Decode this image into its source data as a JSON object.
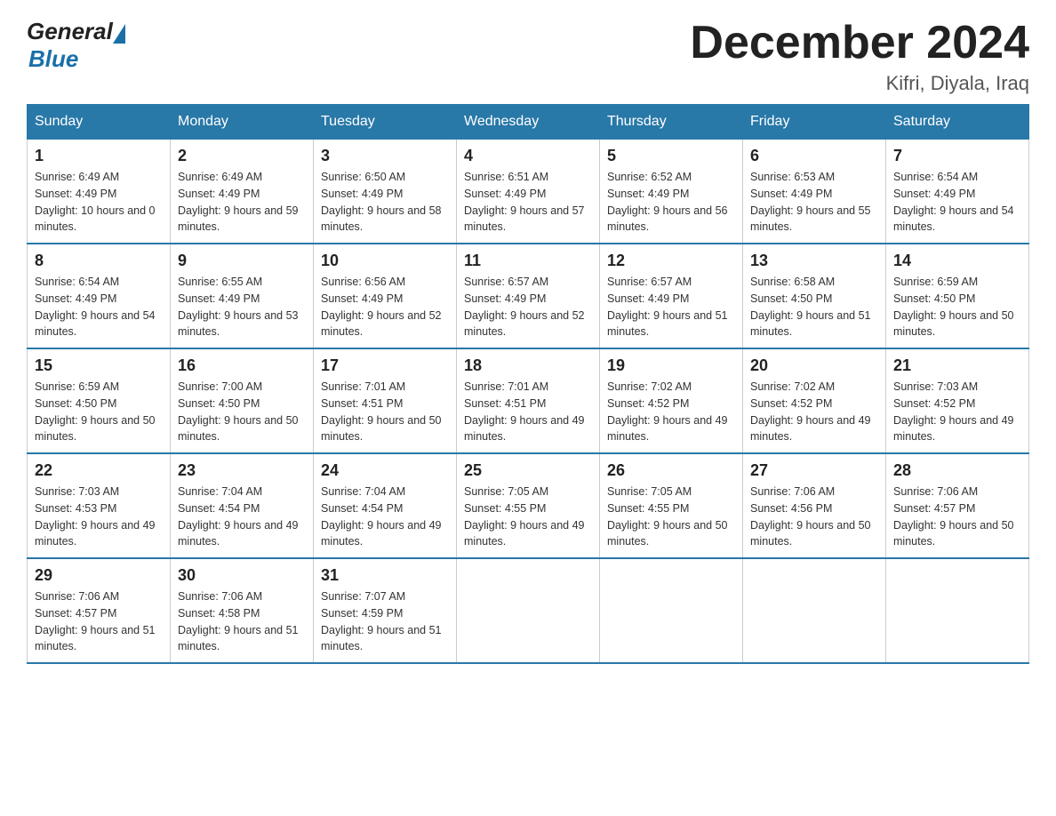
{
  "logo": {
    "general": "General",
    "blue": "Blue"
  },
  "title": "December 2024",
  "location": "Kifri, Diyala, Iraq",
  "days_of_week": [
    "Sunday",
    "Monday",
    "Tuesday",
    "Wednesday",
    "Thursday",
    "Friday",
    "Saturday"
  ],
  "weeks": [
    [
      {
        "day": "1",
        "sunrise": "6:49 AM",
        "sunset": "4:49 PM",
        "daylight": "10 hours and 0 minutes."
      },
      {
        "day": "2",
        "sunrise": "6:49 AM",
        "sunset": "4:49 PM",
        "daylight": "9 hours and 59 minutes."
      },
      {
        "day": "3",
        "sunrise": "6:50 AM",
        "sunset": "4:49 PM",
        "daylight": "9 hours and 58 minutes."
      },
      {
        "day": "4",
        "sunrise": "6:51 AM",
        "sunset": "4:49 PM",
        "daylight": "9 hours and 57 minutes."
      },
      {
        "day": "5",
        "sunrise": "6:52 AM",
        "sunset": "4:49 PM",
        "daylight": "9 hours and 56 minutes."
      },
      {
        "day": "6",
        "sunrise": "6:53 AM",
        "sunset": "4:49 PM",
        "daylight": "9 hours and 55 minutes."
      },
      {
        "day": "7",
        "sunrise": "6:54 AM",
        "sunset": "4:49 PM",
        "daylight": "9 hours and 54 minutes."
      }
    ],
    [
      {
        "day": "8",
        "sunrise": "6:54 AM",
        "sunset": "4:49 PM",
        "daylight": "9 hours and 54 minutes."
      },
      {
        "day": "9",
        "sunrise": "6:55 AM",
        "sunset": "4:49 PM",
        "daylight": "9 hours and 53 minutes."
      },
      {
        "day": "10",
        "sunrise": "6:56 AM",
        "sunset": "4:49 PM",
        "daylight": "9 hours and 52 minutes."
      },
      {
        "day": "11",
        "sunrise": "6:57 AM",
        "sunset": "4:49 PM",
        "daylight": "9 hours and 52 minutes."
      },
      {
        "day": "12",
        "sunrise": "6:57 AM",
        "sunset": "4:49 PM",
        "daylight": "9 hours and 51 minutes."
      },
      {
        "day": "13",
        "sunrise": "6:58 AM",
        "sunset": "4:50 PM",
        "daylight": "9 hours and 51 minutes."
      },
      {
        "day": "14",
        "sunrise": "6:59 AM",
        "sunset": "4:50 PM",
        "daylight": "9 hours and 50 minutes."
      }
    ],
    [
      {
        "day": "15",
        "sunrise": "6:59 AM",
        "sunset": "4:50 PM",
        "daylight": "9 hours and 50 minutes."
      },
      {
        "day": "16",
        "sunrise": "7:00 AM",
        "sunset": "4:50 PM",
        "daylight": "9 hours and 50 minutes."
      },
      {
        "day": "17",
        "sunrise": "7:01 AM",
        "sunset": "4:51 PM",
        "daylight": "9 hours and 50 minutes."
      },
      {
        "day": "18",
        "sunrise": "7:01 AM",
        "sunset": "4:51 PM",
        "daylight": "9 hours and 49 minutes."
      },
      {
        "day": "19",
        "sunrise": "7:02 AM",
        "sunset": "4:52 PM",
        "daylight": "9 hours and 49 minutes."
      },
      {
        "day": "20",
        "sunrise": "7:02 AM",
        "sunset": "4:52 PM",
        "daylight": "9 hours and 49 minutes."
      },
      {
        "day": "21",
        "sunrise": "7:03 AM",
        "sunset": "4:52 PM",
        "daylight": "9 hours and 49 minutes."
      }
    ],
    [
      {
        "day": "22",
        "sunrise": "7:03 AM",
        "sunset": "4:53 PM",
        "daylight": "9 hours and 49 minutes."
      },
      {
        "day": "23",
        "sunrise": "7:04 AM",
        "sunset": "4:54 PM",
        "daylight": "9 hours and 49 minutes."
      },
      {
        "day": "24",
        "sunrise": "7:04 AM",
        "sunset": "4:54 PM",
        "daylight": "9 hours and 49 minutes."
      },
      {
        "day": "25",
        "sunrise": "7:05 AM",
        "sunset": "4:55 PM",
        "daylight": "9 hours and 49 minutes."
      },
      {
        "day": "26",
        "sunrise": "7:05 AM",
        "sunset": "4:55 PM",
        "daylight": "9 hours and 50 minutes."
      },
      {
        "day": "27",
        "sunrise": "7:06 AM",
        "sunset": "4:56 PM",
        "daylight": "9 hours and 50 minutes."
      },
      {
        "day": "28",
        "sunrise": "7:06 AM",
        "sunset": "4:57 PM",
        "daylight": "9 hours and 50 minutes."
      }
    ],
    [
      {
        "day": "29",
        "sunrise": "7:06 AM",
        "sunset": "4:57 PM",
        "daylight": "9 hours and 51 minutes."
      },
      {
        "day": "30",
        "sunrise": "7:06 AM",
        "sunset": "4:58 PM",
        "daylight": "9 hours and 51 minutes."
      },
      {
        "day": "31",
        "sunrise": "7:07 AM",
        "sunset": "4:59 PM",
        "daylight": "9 hours and 51 minutes."
      },
      null,
      null,
      null,
      null
    ]
  ]
}
